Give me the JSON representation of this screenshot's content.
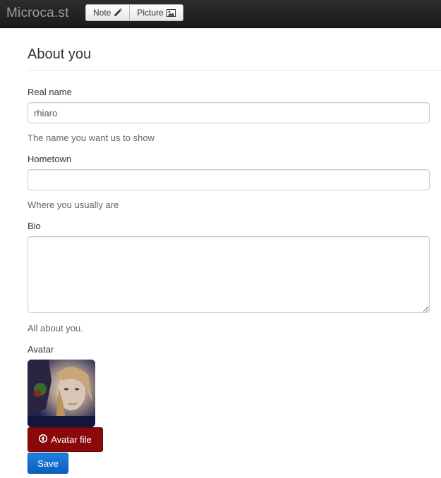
{
  "navbar": {
    "brand": "Microca.st",
    "buttons": [
      {
        "label": "Note",
        "icon": "pencil-icon"
      },
      {
        "label": "Picture",
        "icon": "picture-icon"
      }
    ]
  },
  "page": {
    "title": "About you"
  },
  "form": {
    "real_name": {
      "label": "Real name",
      "value": "rhiaro",
      "help": "The name you want us to show"
    },
    "hometown": {
      "label": "Hometown",
      "value": "",
      "help": "Where you usually are"
    },
    "bio": {
      "label": "Bio",
      "value": "",
      "help": "All about you."
    },
    "avatar": {
      "label": "Avatar",
      "upload_label": "Avatar file",
      "upload_icon": "upload-circle-icon"
    },
    "save_label": "Save"
  },
  "colors": {
    "navbar_bg": "#222222",
    "avatar_button": "#8a0a0a",
    "save_button": "#1a74d2"
  }
}
